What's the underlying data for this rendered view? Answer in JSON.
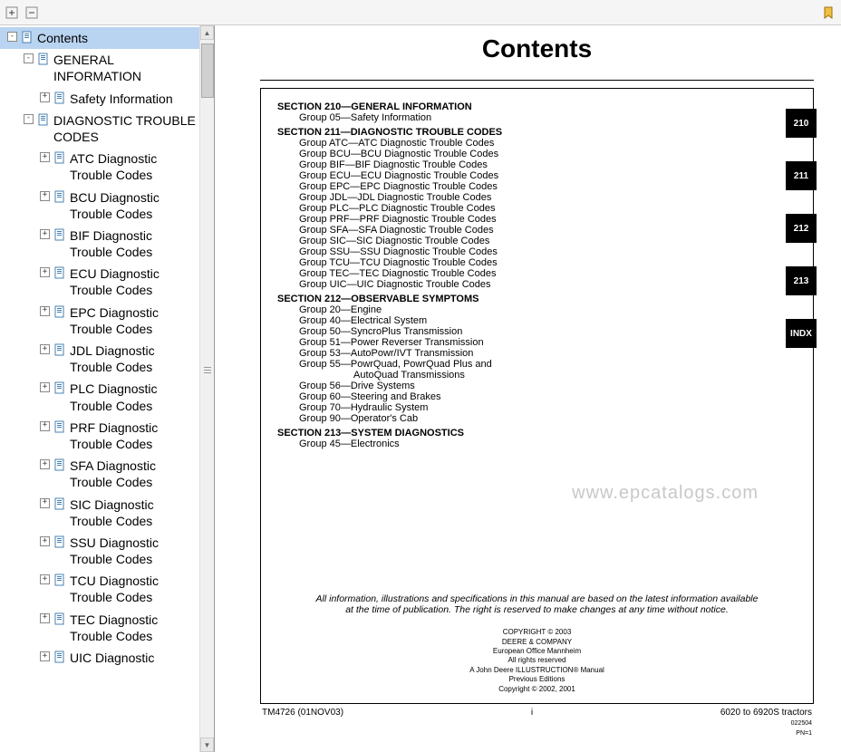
{
  "toolbar": {
    "plus_icon": "plus-icon",
    "minus_icon": "minus-icon",
    "bookmark_icon": "bookmark-icon"
  },
  "sidebar": {
    "items": [
      {
        "level": 0,
        "expand": "-",
        "label": "Contents",
        "selected": true
      },
      {
        "level": 1,
        "expand": "-",
        "label": "GENERAL INFORMATION"
      },
      {
        "level": 2,
        "expand": "+",
        "label": "Safety Information"
      },
      {
        "level": 1,
        "expand": "-",
        "label": "DIAGNOSTIC TROUBLE CODES"
      },
      {
        "level": 2,
        "expand": "+",
        "label": "ATC Diagnostic Trouble Codes"
      },
      {
        "level": 2,
        "expand": "+",
        "label": "BCU Diagnostic Trouble Codes"
      },
      {
        "level": 2,
        "expand": "+",
        "label": "BIF Diagnostic Trouble Codes"
      },
      {
        "level": 2,
        "expand": "+",
        "label": "ECU Diagnostic Trouble Codes"
      },
      {
        "level": 2,
        "expand": "+",
        "label": "EPC Diagnostic Trouble Codes"
      },
      {
        "level": 2,
        "expand": "+",
        "label": "JDL Diagnostic Trouble Codes"
      },
      {
        "level": 2,
        "expand": "+",
        "label": "PLC Diagnostic Trouble Codes"
      },
      {
        "level": 2,
        "expand": "+",
        "label": "PRF Diagnostic Trouble Codes"
      },
      {
        "level": 2,
        "expand": "+",
        "label": "SFA Diagnostic Trouble Codes"
      },
      {
        "level": 2,
        "expand": "+",
        "label": "SIC Diagnostic Trouble Codes"
      },
      {
        "level": 2,
        "expand": "+",
        "label": "SSU Diagnostic Trouble Codes"
      },
      {
        "level": 2,
        "expand": "+",
        "label": "TCU Diagnostic Trouble Codes"
      },
      {
        "level": 2,
        "expand": "+",
        "label": "TEC Diagnostic Trouble Codes"
      },
      {
        "level": 2,
        "expand": "+",
        "label": "UIC Diagnostic"
      }
    ]
  },
  "page": {
    "title": "Contents",
    "sections": [
      {
        "heading": "SECTION 210—GENERAL INFORMATION",
        "groups": [
          "Group 05—Safety Information"
        ]
      },
      {
        "heading": "SECTION 211—DIAGNOSTIC TROUBLE CODES",
        "groups": [
          "Group ATC—ATC Diagnostic Trouble Codes",
          "Group BCU—BCU Diagnostic Trouble Codes",
          "Group BIF—BIF Diagnostic Trouble Codes",
          "Group ECU—ECU Diagnostic Trouble Codes",
          "Group EPC—EPC Diagnostic Trouble Codes",
          "Group JDL—JDL Diagnostic Trouble Codes",
          "Group PLC—PLC Diagnostic Trouble Codes",
          "Group PRF—PRF Diagnostic Trouble Codes",
          "Group SFA—SFA Diagnostic Trouble Codes",
          "Group SIC—SIC Diagnostic Trouble Codes",
          "Group SSU—SSU Diagnostic Trouble Codes",
          "Group TCU—TCU Diagnostic Trouble Codes",
          "Group TEC—TEC Diagnostic Trouble Codes",
          "Group UIC—UIC Diagnostic Trouble Codes"
        ]
      },
      {
        "heading": "SECTION 212—OBSERVABLE SYMPTOMS",
        "groups": [
          "Group 20—Engine",
          "Group 40—Electrical System",
          "Group 50—SyncroPlus Transmission",
          "Group 51—Power Reverser Transmission",
          "Group 53—AutoPowr/IVT Transmission",
          "Group 55—PowrQuad, PowrQuad Plus and",
          {
            "indent": true,
            "text": "AutoQuad Transmissions"
          },
          "Group 56—Drive Systems",
          "Group 60—Steering and Brakes",
          "Group 70—Hydraulic System",
          "Group 90—Operator's Cab"
        ]
      },
      {
        "heading": "SECTION 213—SYSTEM DIAGNOSTICS",
        "groups": [
          "Group 45—Electronics"
        ]
      }
    ],
    "tabs": [
      "210",
      "211",
      "212",
      "213",
      "INDX"
    ],
    "disclaimer": "All information, illustrations and specifications in this manual are based on the latest information available at the time of publication. The right is reserved to make changes at any time without notice.",
    "copyright": [
      "COPYRIGHT © 2003",
      "DEERE & COMPANY",
      "European Office Mannheim",
      "All rights reserved",
      "A John Deere ILLUSTRUCTION® Manual",
      "Previous Editions",
      "Copyright © 2002, 2001"
    ],
    "watermark": "www.epcatalogs.com",
    "footer": {
      "left": "TM4726 (01NOV03)",
      "center": "i",
      "right": "6020 to 6920S tractors",
      "right_sub": "022504",
      "right_sub2": "PN=1"
    }
  }
}
